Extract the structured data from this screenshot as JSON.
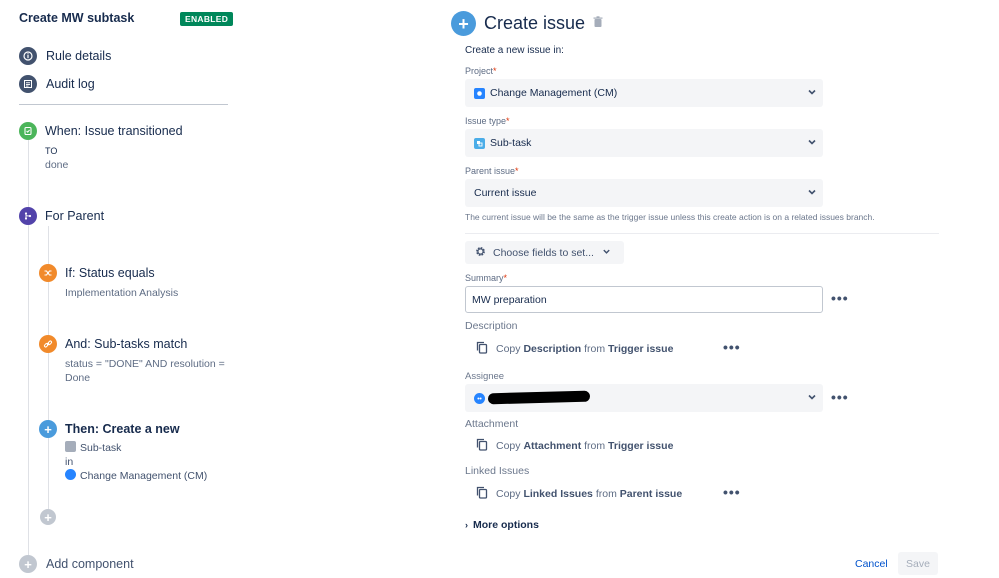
{
  "rule": {
    "title": "Create MW subtask",
    "status_badge": "ENABLED"
  },
  "nav": {
    "rule_details": "Rule details",
    "audit_log": "Audit log"
  },
  "components": {
    "trigger": {
      "title": "When: Issue transitioned",
      "to_label": "TO",
      "to_value": "done"
    },
    "branch": {
      "title": "For Parent"
    },
    "condition1": {
      "title": "If: Status equals",
      "detail": "Implementation Analysis"
    },
    "condition2": {
      "title": "And: Sub-tasks match",
      "detail_line1": "status = \"DONE\" AND resolution =",
      "detail_line2": "Done"
    },
    "action": {
      "title": "Then: Create a new",
      "type": "Sub-task",
      "in": "in",
      "project": "Change Management (CM)"
    }
  },
  "add_component": "Add component",
  "editor": {
    "title": "Create issue",
    "create_in": "Create a new issue in:",
    "project": {
      "label": "Project",
      "value": "Change Management (CM)"
    },
    "issue_type": {
      "label": "Issue type",
      "value": "Sub-task"
    },
    "parent_issue": {
      "label": "Parent issue",
      "value": "Current issue",
      "help": "The current issue will be the same as the trigger issue unless this create action is on a related issues branch."
    },
    "choose_fields": "Choose fields to set...",
    "summary": {
      "label": "Summary",
      "value": "MW preparation"
    },
    "description": {
      "label": "Description",
      "copy": "Copy",
      "field": "Description",
      "from": "from",
      "source": "Trigger issue"
    },
    "assignee": {
      "label": "Assignee"
    },
    "attachment": {
      "label": "Attachment",
      "copy": "Copy",
      "field": "Attachment",
      "from": "from",
      "source": "Trigger issue"
    },
    "linked_issues": {
      "label": "Linked Issues",
      "copy": "Copy",
      "field": "Linked Issues",
      "from": "from",
      "source": "Parent issue"
    },
    "more_options": "More options",
    "cancel": "Cancel",
    "save": "Save",
    "required_mark": "*"
  },
  "colors": {
    "trigger": "#4bb55a",
    "branch": "#5243aa",
    "condition": "#f18a2b",
    "action": "#4a9bdc",
    "badge": "#00875a"
  }
}
